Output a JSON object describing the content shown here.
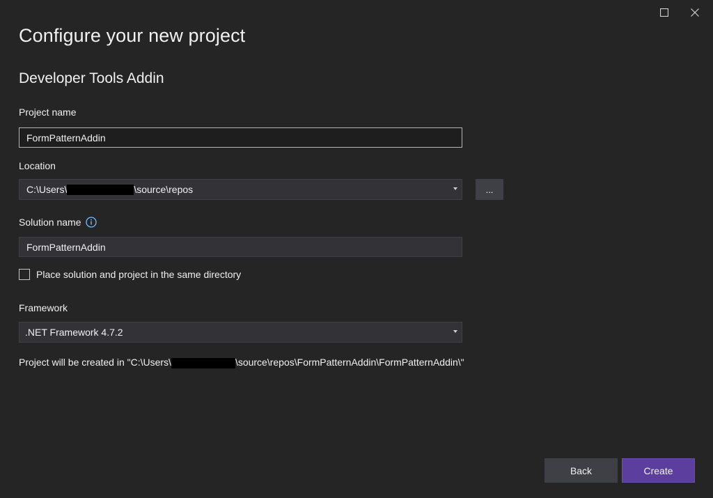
{
  "window": {
    "controls": [
      "maximize-icon",
      "close-icon"
    ]
  },
  "header": {
    "title": "Configure your new project",
    "template_name": "Developer Tools Addin"
  },
  "form": {
    "project_name": {
      "label": "Project name",
      "value": "FormPatternAddin"
    },
    "location": {
      "label": "Location",
      "value_prefix": "C:\\Users\\",
      "value_suffix": "\\source\\repos",
      "browse_label": "..."
    },
    "solution_name": {
      "label": "Solution name",
      "value": "FormPatternAddin",
      "info_icon": "info-icon"
    },
    "same_directory": {
      "label": "Place solution and project in the same directory",
      "checked": false
    },
    "framework": {
      "label": "Framework",
      "selected": ".NET Framework 4.7.2"
    },
    "result": {
      "prefix": "Project will be created in \"C:\\Users\\",
      "suffix": "\\source\\repos\\FormPatternAddin\\FormPatternAddin\\\""
    }
  },
  "footer": {
    "back_label": "Back",
    "create_label": "Create"
  },
  "colors": {
    "background": "#252526",
    "input_bg": "#333337",
    "button_bg": "#3f3f46",
    "accent": "#5c3e9e",
    "info_blue": "#75beff"
  }
}
